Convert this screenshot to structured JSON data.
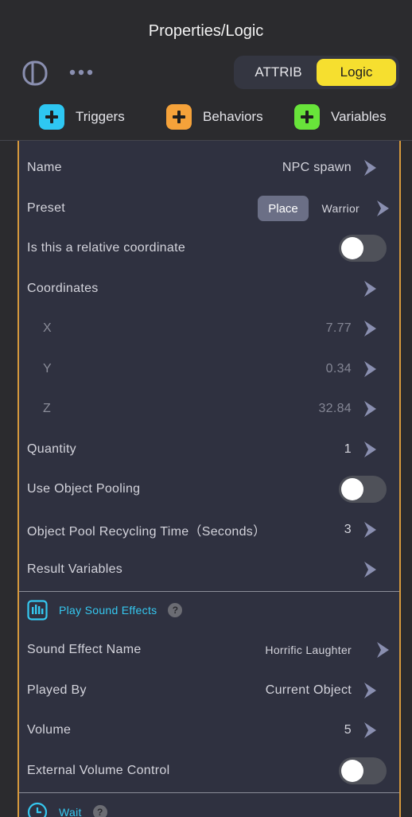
{
  "header": {
    "title": "Properties/Logic",
    "tabs": {
      "attrib": "ATTRIB",
      "logic": "Logic"
    }
  },
  "adders": [
    {
      "label": "Triggers",
      "color": "#2ec7f2",
      "icon": "plus-icon"
    },
    {
      "label": "Behaviors",
      "color": "#f5a23a",
      "icon": "plus-icon"
    },
    {
      "label": "Variables",
      "color": "#68e43a",
      "icon": "plus-icon"
    }
  ],
  "spawn": {
    "name_label": "Name",
    "name_value": "NPC spawn",
    "preset_label": "Preset",
    "preset_chip": "Place",
    "preset_value": "Warrior",
    "relative_label": "Is this a relative coordinate",
    "coords_label": "Coordinates",
    "x_label": "X",
    "x_value": "7.77",
    "y_label": "Y",
    "y_value": "0.34",
    "z_label": "Z",
    "z_value": "32.84",
    "quantity_label": "Quantity",
    "quantity_value": "1",
    "pooling_label": "Use Object Pooling",
    "recycle_label": "Object Pool Recycling Time（Seconds）",
    "recycle_value": "3",
    "result_label": "Result Variables"
  },
  "sound": {
    "title": "Play Sound Effects",
    "help": "?",
    "effect_label": "Sound Effect Name",
    "effect_value": "Horrific Laughter",
    "played_label": "Played By",
    "played_value": "Current Object",
    "volume_label": "Volume",
    "volume_value": "5",
    "external_label": "External Volume Control"
  },
  "wait": {
    "title": "Wait",
    "help": "?"
  },
  "colors": {
    "accent_yellow": "#f6df2f",
    "card_border": "#d6993c",
    "section_title": "#35c8f0"
  }
}
